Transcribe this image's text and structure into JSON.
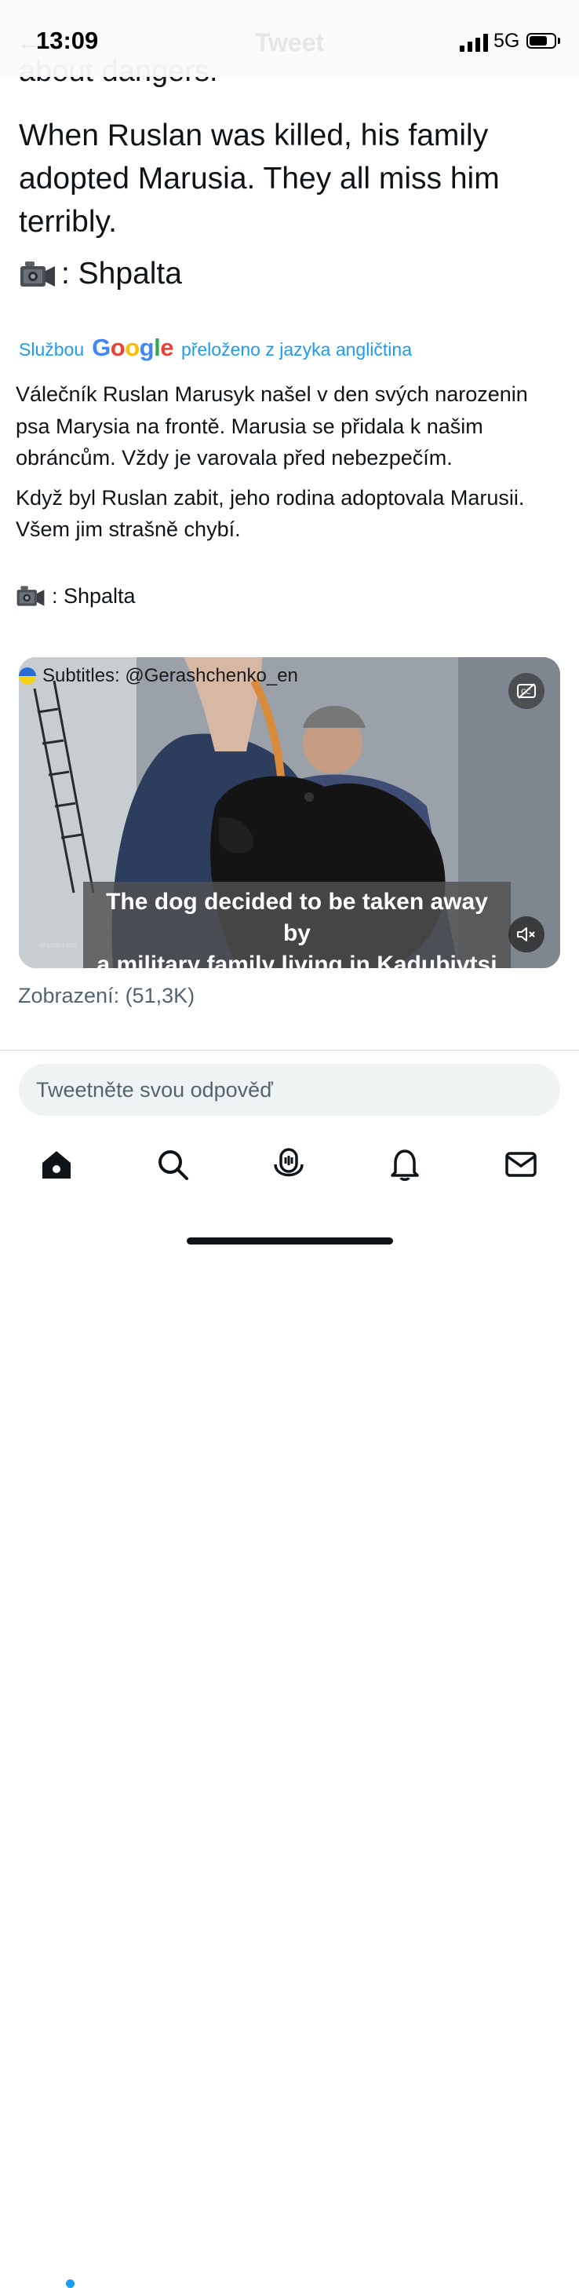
{
  "status_bar": {
    "time": "13:09",
    "network": "5G",
    "ghost_title": "Tweet",
    "signal_icon": "cellular-signal-icon",
    "battery_icon": "battery-icon"
  },
  "tweet": {
    "partial_line": "about dangers.",
    "paragraph": "When Ruslan was killed, his family adopted Marusia. They all miss him terribly.",
    "credit": ": Shpalta",
    "credit_icon": "video-camera-icon"
  },
  "translation": {
    "prefix": "Službou",
    "google": "Google",
    "suffix": "přeloženo z jazyka angličtina",
    "paragraph1": "Válečník Ruslan Marusyk našel v den svých narozenin psa Marysia na frontě. Marusia se přidala k našim obráncům. Vždy je varovala před nebezpečím.",
    "paragraph2": "Když byl Ruslan zabit, jeho rodina adoptovala Marusii. Všem jim strašně chybí.",
    "credit": ": Shpalta"
  },
  "video": {
    "subtitle_tag": "Subtitles: @Gerashchenko_en",
    "caption_line1": "The dog decided to be taken away by",
    "caption_line2": "a military family living in Kadubivtsi",
    "watermark": "shpalta.me",
    "cc_icon": "captions-off-icon",
    "mute_icon": "muted-speaker-icon"
  },
  "views": "Zobrazení: (51,3K)",
  "reply": {
    "placeholder": "Tweetněte svou odpověď"
  },
  "tabbar": {
    "items": [
      "home-icon",
      "search-icon",
      "spaces-icon",
      "notifications-bell-icon",
      "messages-envelope-icon"
    ]
  },
  "colors": {
    "accent": "#1d9bf0",
    "text": "#0f1419",
    "secondary": "#536471"
  }
}
